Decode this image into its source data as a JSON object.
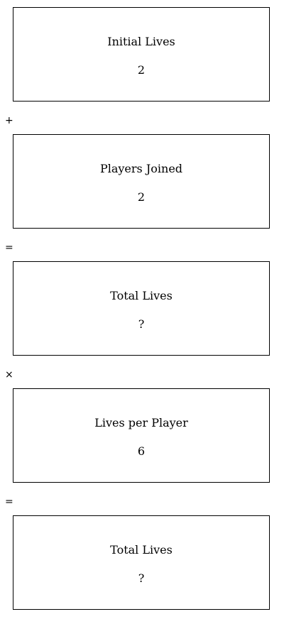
{
  "steps": [
    {
      "title": "Initial Lives",
      "value": "2"
    },
    {
      "title": "Players Joined",
      "value": "2"
    },
    {
      "title": "Total Lives",
      "value": "?"
    },
    {
      "title": "Lives per Player",
      "value": "6"
    },
    {
      "title": "Total Lives",
      "value": "?"
    }
  ],
  "operators": [
    "+",
    "=",
    "×",
    "="
  ]
}
